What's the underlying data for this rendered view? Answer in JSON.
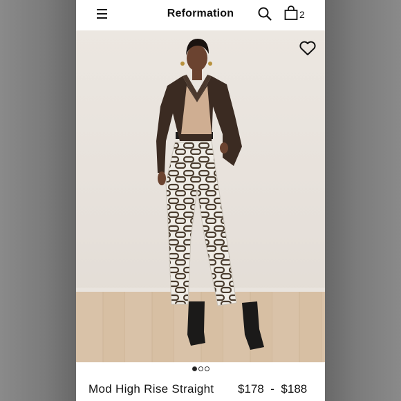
{
  "header": {
    "brand": "Reformation",
    "bag_count": "2"
  },
  "icons": {
    "menu": "hamburger-menu-icon",
    "search": "search-icon",
    "bag": "shopping-bag-icon",
    "wishlist": "heart-icon"
  },
  "gallery": {
    "image_count": 3,
    "active_index": 0
  },
  "product": {
    "name": "Mod High Rise Straight",
    "price_low": "$178",
    "price_sep": "-",
    "price_high": "$188"
  }
}
